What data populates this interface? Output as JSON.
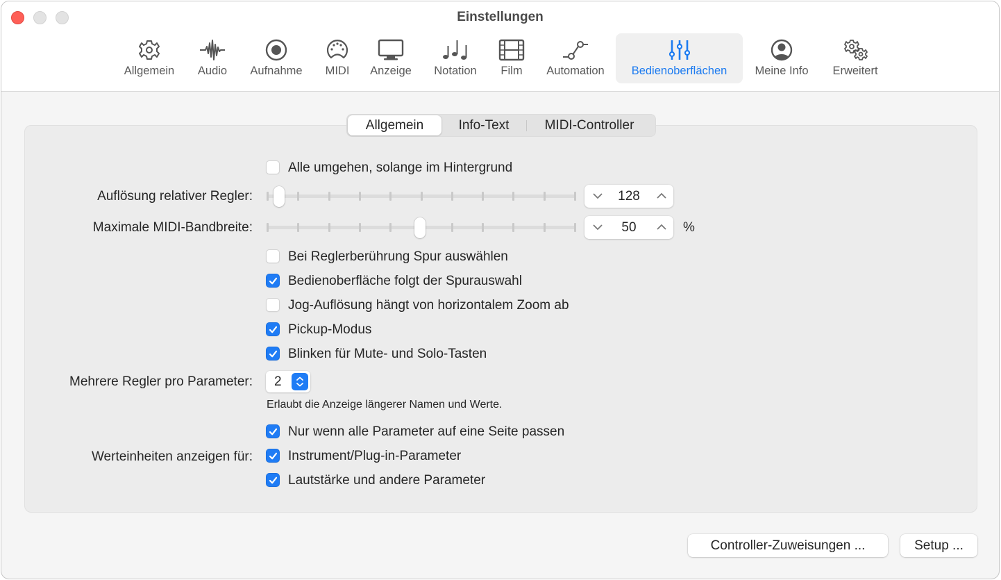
{
  "window": {
    "title": "Einstellungen",
    "traffic_lights": [
      "close",
      "minimize",
      "zoom"
    ]
  },
  "toolbar": {
    "items": [
      {
        "id": "allgemein",
        "label": "Allgemein",
        "icon": "gear-icon",
        "active": false
      },
      {
        "id": "audio",
        "label": "Audio",
        "icon": "waveform-icon",
        "active": false
      },
      {
        "id": "aufnahme",
        "label": "Aufnahme",
        "icon": "record-icon",
        "active": false
      },
      {
        "id": "midi",
        "label": "MIDI",
        "icon": "midi-port-icon",
        "active": false
      },
      {
        "id": "anzeige",
        "label": "Anzeige",
        "icon": "monitor-icon",
        "active": false
      },
      {
        "id": "notation",
        "label": "Notation",
        "icon": "music-notes-icon",
        "active": false
      },
      {
        "id": "film",
        "label": "Film",
        "icon": "film-icon",
        "active": false
      },
      {
        "id": "automation",
        "label": "Automation",
        "icon": "automation-curve-icon",
        "active": false
      },
      {
        "id": "bedienoberflaechen",
        "label": "Bedienoberflächen",
        "icon": "sliders-icon",
        "active": true
      },
      {
        "id": "meine-info",
        "label": "Meine Info",
        "icon": "person-circle-icon",
        "active": false
      },
      {
        "id": "erweitert",
        "label": "Erweitert",
        "icon": "gears-icon",
        "active": false
      }
    ],
    "accent_color": "#1c7bf0"
  },
  "tabs": {
    "items": [
      "Allgemein",
      "Info-Text",
      "MIDI-Controller"
    ],
    "selected": "Allgemein"
  },
  "settings": {
    "bypass_background": {
      "label": "Alle umgehen, solange im Hintergrund",
      "checked": false
    },
    "relative_resolution": {
      "label": "Auflösung relativer Regler:",
      "value": "128",
      "slider_fraction": 0.02
    },
    "max_midi_bandwidth": {
      "label": "Maximale MIDI-Bandbreite:",
      "value": "50",
      "unit": "%",
      "slider_fraction": 0.5
    },
    "checkboxes_1": [
      {
        "label": "Bei Reglerberührung Spur auswählen",
        "checked": false
      },
      {
        "label": "Bedienoberfläche folgt der Spurauswahl",
        "checked": true
      },
      {
        "label": "Jog-Auflösung hängt von horizontalem Zoom ab",
        "checked": false
      },
      {
        "label": "Pickup-Modus",
        "checked": true
      },
      {
        "label": "Blinken für Mute- und Solo-Tasten",
        "checked": true
      }
    ],
    "multiple_controls": {
      "label": "Mehrere Regler pro Parameter:",
      "value": "2",
      "help": "Erlaubt die Anzeige längerer Namen und Werte."
    },
    "only_if_fits": {
      "label": "Nur wenn alle Parameter auf eine Seite passen",
      "checked": true
    },
    "value_units": {
      "label": "Werteinheiten anzeigen für:",
      "options": [
        {
          "label": "Instrument/Plug-in-Parameter",
          "checked": true
        },
        {
          "label": "Lautstärke und andere Parameter",
          "checked": true
        }
      ]
    }
  },
  "buttons": {
    "controller_assignments": "Controller-Zuweisungen ...",
    "setup": "Setup ..."
  }
}
